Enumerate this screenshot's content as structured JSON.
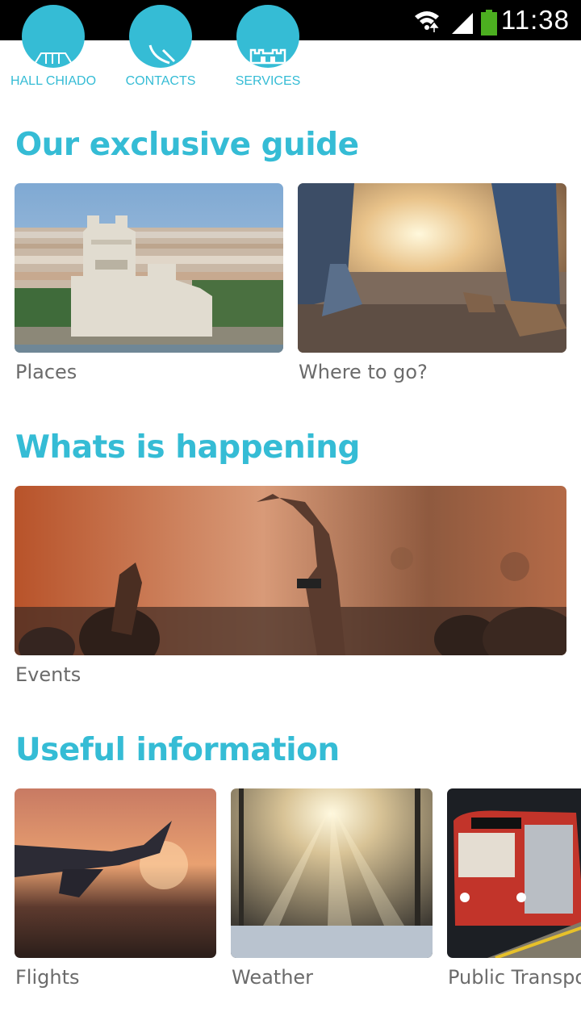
{
  "status_bar": {
    "time": "11:38",
    "icons": [
      "wifi-icon",
      "signal-icon",
      "battery-icon"
    ]
  },
  "quick_actions": [
    {
      "label": "HALL CHIADO",
      "icon": "building-icon"
    },
    {
      "label": "CONTACTS",
      "icon": "phone-icon"
    },
    {
      "label": "SERVICES",
      "icon": "castle-icon"
    }
  ],
  "sections": {
    "guide": {
      "title": "Our exclusive guide",
      "items": [
        {
          "label": "Places"
        },
        {
          "label": "Where to go?"
        }
      ]
    },
    "happening": {
      "title": "Whats is happening",
      "items": [
        {
          "label": "Events"
        }
      ]
    },
    "useful": {
      "title": "Useful information",
      "items": [
        {
          "label": "Flights"
        },
        {
          "label": "Weather"
        },
        {
          "label": "Public Transport"
        }
      ]
    }
  },
  "colors": {
    "accent": "#35bcd5",
    "caption": "#6b6b6b",
    "status_bar": "#000000",
    "battery": "#4caf20"
  }
}
